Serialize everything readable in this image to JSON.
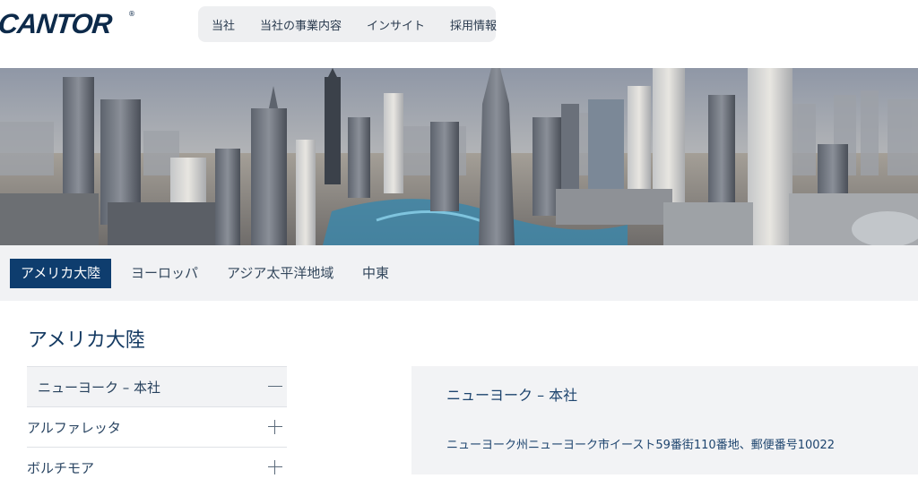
{
  "header": {
    "logo_text": "CANTOR",
    "logo_mark": "®",
    "nav": [
      "当社",
      "当社の事業内容",
      "インサイト",
      "採用情報"
    ]
  },
  "hero": {
    "image": "city-skyline-photo",
    "colors": {
      "sky": "#9aa4b3",
      "water": "#3d86a8"
    }
  },
  "region_tabs": {
    "items": [
      "アメリカ大陸",
      "ヨーロッパ",
      "アジア太平洋地域",
      "中東"
    ],
    "active_index": 0
  },
  "section": {
    "title": "アメリカ大陸"
  },
  "offices": {
    "items": [
      {
        "name": "ニューヨーク – 本社",
        "expanded": true
      },
      {
        "name": "アルファレッタ",
        "expanded": false
      },
      {
        "name": "ボルチモア",
        "expanded": false
      }
    ]
  },
  "detail": {
    "title": "ニューヨーク – 本社",
    "address": "ニューヨーク州ニューヨーク市イースト59番街110番地、郵便番号10022"
  },
  "colors": {
    "brand_navy": "#0e3d6e",
    "text_blue": "#1d446e",
    "panel_bg": "#f2f3f5"
  }
}
